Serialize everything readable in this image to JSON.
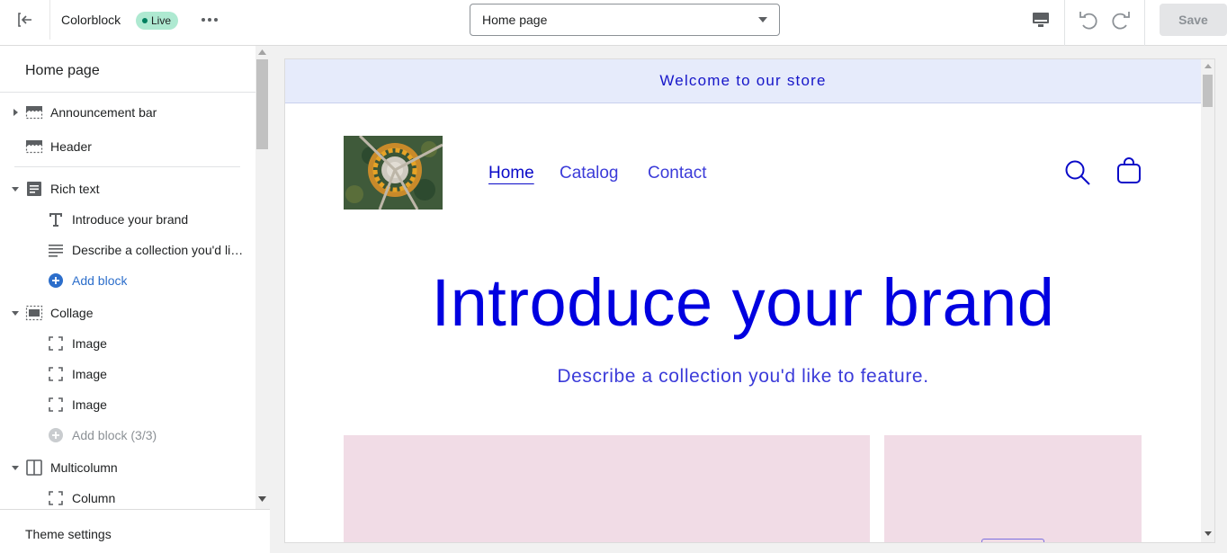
{
  "topbar": {
    "theme_name": "Colorblock",
    "live_label": "Live",
    "page_select_value": "Home page",
    "save_label": "Save"
  },
  "sidebar": {
    "title": "Home page",
    "items": [
      {
        "label": "Announcement bar",
        "icon": "section-icon"
      },
      {
        "label": "Header",
        "icon": "section-icon"
      },
      {
        "label": "Rich text",
        "icon": "text-block-icon"
      },
      {
        "label": "Introduce your brand",
        "icon": "heading-icon"
      },
      {
        "label": "Describe a collection you'd like to feature.",
        "icon": "paragraph-icon"
      },
      {
        "label": "Add block",
        "icon": "plus-circle-icon"
      },
      {
        "label": "Collage",
        "icon": "collage-icon"
      },
      {
        "label": "Image",
        "icon": "image-block-icon"
      },
      {
        "label": "Image",
        "icon": "image-block-icon"
      },
      {
        "label": "Image",
        "icon": "image-block-icon"
      },
      {
        "label": "Add block (3/3)",
        "icon": "plus-circle-icon"
      },
      {
        "label": "Multicolumn",
        "icon": "columns-icon"
      },
      {
        "label": "Column",
        "icon": "column-block-icon"
      }
    ],
    "footer_label": "Theme settings"
  },
  "preview": {
    "announcement": "Welcome to our store",
    "nav": [
      "Home",
      "Catalog",
      "Contact"
    ],
    "hero_title": "Introduce your brand",
    "hero_subtitle": "Describe a collection you'd like to feature."
  },
  "colors": {
    "accent_text": "#0000e0",
    "announcement_bg": "#e6ebfb",
    "collage_bg": "#f1dce6",
    "live_badge_bg": "#aee9d1",
    "link_blue": "#2c6ecb"
  }
}
